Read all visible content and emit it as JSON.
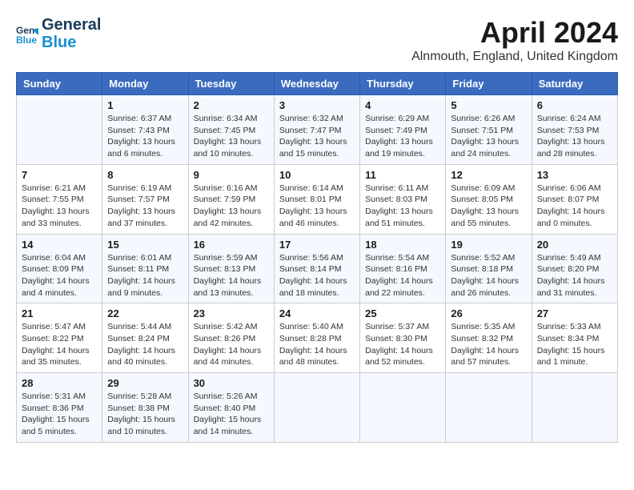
{
  "header": {
    "logo": {
      "line1": "General",
      "line2": "Blue"
    },
    "title": "April 2024",
    "location": "Alnmouth, England, United Kingdom"
  },
  "weekdays": [
    "Sunday",
    "Monday",
    "Tuesday",
    "Wednesday",
    "Thursday",
    "Friday",
    "Saturday"
  ],
  "weeks": [
    [
      {
        "day": "",
        "info": ""
      },
      {
        "day": "1",
        "info": "Sunrise: 6:37 AM\nSunset: 7:43 PM\nDaylight: 13 hours\nand 6 minutes."
      },
      {
        "day": "2",
        "info": "Sunrise: 6:34 AM\nSunset: 7:45 PM\nDaylight: 13 hours\nand 10 minutes."
      },
      {
        "day": "3",
        "info": "Sunrise: 6:32 AM\nSunset: 7:47 PM\nDaylight: 13 hours\nand 15 minutes."
      },
      {
        "day": "4",
        "info": "Sunrise: 6:29 AM\nSunset: 7:49 PM\nDaylight: 13 hours\nand 19 minutes."
      },
      {
        "day": "5",
        "info": "Sunrise: 6:26 AM\nSunset: 7:51 PM\nDaylight: 13 hours\nand 24 minutes."
      },
      {
        "day": "6",
        "info": "Sunrise: 6:24 AM\nSunset: 7:53 PM\nDaylight: 13 hours\nand 28 minutes."
      }
    ],
    [
      {
        "day": "7",
        "info": "Sunrise: 6:21 AM\nSunset: 7:55 PM\nDaylight: 13 hours\nand 33 minutes."
      },
      {
        "day": "8",
        "info": "Sunrise: 6:19 AM\nSunset: 7:57 PM\nDaylight: 13 hours\nand 37 minutes."
      },
      {
        "day": "9",
        "info": "Sunrise: 6:16 AM\nSunset: 7:59 PM\nDaylight: 13 hours\nand 42 minutes."
      },
      {
        "day": "10",
        "info": "Sunrise: 6:14 AM\nSunset: 8:01 PM\nDaylight: 13 hours\nand 46 minutes."
      },
      {
        "day": "11",
        "info": "Sunrise: 6:11 AM\nSunset: 8:03 PM\nDaylight: 13 hours\nand 51 minutes."
      },
      {
        "day": "12",
        "info": "Sunrise: 6:09 AM\nSunset: 8:05 PM\nDaylight: 13 hours\nand 55 minutes."
      },
      {
        "day": "13",
        "info": "Sunrise: 6:06 AM\nSunset: 8:07 PM\nDaylight: 14 hours\nand 0 minutes."
      }
    ],
    [
      {
        "day": "14",
        "info": "Sunrise: 6:04 AM\nSunset: 8:09 PM\nDaylight: 14 hours\nand 4 minutes."
      },
      {
        "day": "15",
        "info": "Sunrise: 6:01 AM\nSunset: 8:11 PM\nDaylight: 14 hours\nand 9 minutes."
      },
      {
        "day": "16",
        "info": "Sunrise: 5:59 AM\nSunset: 8:13 PM\nDaylight: 14 hours\nand 13 minutes."
      },
      {
        "day": "17",
        "info": "Sunrise: 5:56 AM\nSunset: 8:14 PM\nDaylight: 14 hours\nand 18 minutes."
      },
      {
        "day": "18",
        "info": "Sunrise: 5:54 AM\nSunset: 8:16 PM\nDaylight: 14 hours\nand 22 minutes."
      },
      {
        "day": "19",
        "info": "Sunrise: 5:52 AM\nSunset: 8:18 PM\nDaylight: 14 hours\nand 26 minutes."
      },
      {
        "day": "20",
        "info": "Sunrise: 5:49 AM\nSunset: 8:20 PM\nDaylight: 14 hours\nand 31 minutes."
      }
    ],
    [
      {
        "day": "21",
        "info": "Sunrise: 5:47 AM\nSunset: 8:22 PM\nDaylight: 14 hours\nand 35 minutes."
      },
      {
        "day": "22",
        "info": "Sunrise: 5:44 AM\nSunset: 8:24 PM\nDaylight: 14 hours\nand 40 minutes."
      },
      {
        "day": "23",
        "info": "Sunrise: 5:42 AM\nSunset: 8:26 PM\nDaylight: 14 hours\nand 44 minutes."
      },
      {
        "day": "24",
        "info": "Sunrise: 5:40 AM\nSunset: 8:28 PM\nDaylight: 14 hours\nand 48 minutes."
      },
      {
        "day": "25",
        "info": "Sunrise: 5:37 AM\nSunset: 8:30 PM\nDaylight: 14 hours\nand 52 minutes."
      },
      {
        "day": "26",
        "info": "Sunrise: 5:35 AM\nSunset: 8:32 PM\nDaylight: 14 hours\nand 57 minutes."
      },
      {
        "day": "27",
        "info": "Sunrise: 5:33 AM\nSunset: 8:34 PM\nDaylight: 15 hours\nand 1 minute."
      }
    ],
    [
      {
        "day": "28",
        "info": "Sunrise: 5:31 AM\nSunset: 8:36 PM\nDaylight: 15 hours\nand 5 minutes."
      },
      {
        "day": "29",
        "info": "Sunrise: 5:28 AM\nSunset: 8:38 PM\nDaylight: 15 hours\nand 10 minutes."
      },
      {
        "day": "30",
        "info": "Sunrise: 5:26 AM\nSunset: 8:40 PM\nDaylight: 15 hours\nand 14 minutes."
      },
      {
        "day": "",
        "info": ""
      },
      {
        "day": "",
        "info": ""
      },
      {
        "day": "",
        "info": ""
      },
      {
        "day": "",
        "info": ""
      }
    ]
  ]
}
